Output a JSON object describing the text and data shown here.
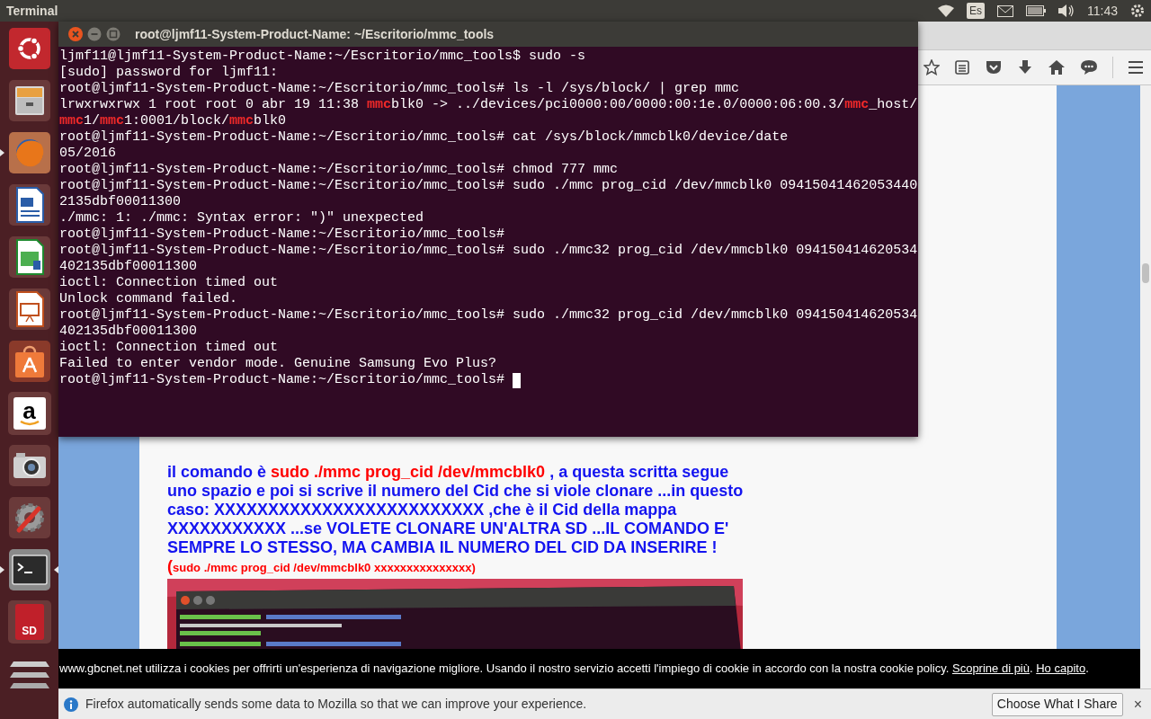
{
  "top_panel": {
    "app_title": "Terminal",
    "keyboard_layout": "Es",
    "time": "11:43"
  },
  "launcher": [
    {
      "kind": "ubuntu",
      "running": false,
      "focused": false
    },
    {
      "kind": "files",
      "running": false,
      "focused": false
    },
    {
      "kind": "firefox",
      "running": true,
      "focused": false
    },
    {
      "kind": "writer",
      "running": false,
      "focused": false
    },
    {
      "kind": "calc",
      "running": false,
      "focused": false
    },
    {
      "kind": "impress",
      "running": false,
      "focused": false
    },
    {
      "kind": "software",
      "running": false,
      "focused": false
    },
    {
      "kind": "amazon",
      "running": false,
      "focused": false,
      "glyph": "a"
    },
    {
      "kind": "camera",
      "running": false,
      "focused": false
    },
    {
      "kind": "settings",
      "running": false,
      "focused": false
    },
    {
      "kind": "terminal",
      "running": true,
      "focused": true
    },
    {
      "kind": "sdcard",
      "running": false,
      "focused": false,
      "glyph": "SD"
    },
    {
      "kind": "drives",
      "running": false,
      "focused": false
    }
  ],
  "terminal": {
    "title": "root@ljmf11-System-Product-Name: ~/Escritorio/mmc_tools",
    "cursor": true,
    "lines": [
      [
        {
          "text": "ljmf11@ljmf11-System-Product-Name:~/Escritorio/mmc_tools$ sudo -s",
          "match": false
        }
      ],
      [
        {
          "text": "[sudo] password for ljmf11:",
          "match": false
        }
      ],
      [
        {
          "text": "root@ljmf11-System-Product-Name:~/Escritorio/mmc_tools# ls -l /sys/block/ | grep mmc",
          "match": false
        }
      ],
      [
        {
          "text": "lrwxrwxrwx 1 root root 0 abr 19 11:38 ",
          "match": false
        },
        {
          "text": "mmc",
          "match": true
        },
        {
          "text": "blk0 -> ../devices/pci0000:00/0000:00:1e.0/0000:06:00.3/",
          "match": false
        },
        {
          "text": "mmc",
          "match": true
        },
        {
          "text": "_host/",
          "match": false
        }
      ],
      [
        {
          "text": "mmc",
          "match": true
        },
        {
          "text": "1/",
          "match": false
        },
        {
          "text": "mmc",
          "match": true
        },
        {
          "text": "1:0001/block/",
          "match": false
        },
        {
          "text": "mmc",
          "match": true
        },
        {
          "text": "blk0",
          "match": false
        }
      ],
      [
        {
          "text": "root@ljmf11-System-Product-Name:~/Escritorio/mmc_tools# cat /sys/block/mmcblk0/device/date",
          "match": false
        }
      ],
      [
        {
          "text": "05/2016",
          "match": false
        }
      ],
      [
        {
          "text": "root@ljmf11-System-Product-Name:~/Escritorio/mmc_tools# chmod 777 mmc",
          "match": false
        }
      ],
      [
        {
          "text": "root@ljmf11-System-Product-Name:~/Escritorio/mmc_tools# sudo ./mmc prog_cid /dev/mmcblk0 09415041462053440",
          "match": false
        }
      ],
      [
        {
          "text": "2135dbf00011300",
          "match": false
        }
      ],
      [
        {
          "text": "./mmc: 1: ./mmc: Syntax error: \")\" unexpected",
          "match": false
        }
      ],
      [
        {
          "text": "root@ljmf11-System-Product-Name:~/Escritorio/mmc_tools#",
          "match": false
        }
      ],
      [
        {
          "text": "root@ljmf11-System-Product-Name:~/Escritorio/mmc_tools# sudo ./mmc32 prog_cid /dev/mmcblk0 094150414620534",
          "match": false
        }
      ],
      [
        {
          "text": "402135dbf00011300",
          "match": false
        }
      ],
      [
        {
          "text": "ioctl: Connection timed out",
          "match": false
        }
      ],
      [
        {
          "text": "Unlock command failed.",
          "match": false
        }
      ],
      [
        {
          "text": "root@ljmf11-System-Product-Name:~/Escritorio/mmc_tools# sudo ./mmc32 prog_cid /dev/mmcblk0 094150414620534",
          "match": false
        }
      ],
      [
        {
          "text": "402135dbf00011300",
          "match": false
        }
      ],
      [
        {
          "text": "ioctl: Connection timed out",
          "match": false
        }
      ],
      [
        {
          "text": "Failed to enter vendor mode. Genuine Samsung Evo Plus?",
          "match": false
        }
      ],
      [
        {
          "text": "root@ljmf11-System-Product-Name:~/Escritorio/mmc_tools# ",
          "match": false
        }
      ]
    ]
  },
  "page": {
    "paragraph": [
      {
        "kind": "text",
        "text": "il comando è "
      },
      {
        "kind": "command",
        "text": "sudo ./mmc prog_cid /dev/mmcblk0"
      },
      {
        "kind": "text",
        "text": " , a questa scritta segue uno spazio e poi si scrive il numero del Cid che si viole clonare ...in questo caso: XXXXXXXXXXXXXXXXXXXXXXXXX ,che è il Cid della mappa XXXXXXXXXXX ...se VOLETE CLONARE UN'ALTRA SD ...IL COMANDO E' SEMPRE LO STESSO, MA CAMBIA IL NUMERO DEL CID DA INSERIRE ! "
      },
      {
        "kind": "command",
        "text": "("
      },
      {
        "kind": "note",
        "text": "sudo ./mmc prog_cid /dev/mmcblk0 xxxxxxxxxxxxxxx)"
      }
    ]
  },
  "cookie_bar": [
    {
      "kind": "text",
      "text": "www.gbcnet.net utilizza i cookies per offrirti un'esperienza di navigazione migliore. Usando il nostro servizio accetti l'impiego di cookie in accordo con la nostra cookie policy. "
    },
    {
      "kind": "link",
      "text": "Scoprine di più"
    },
    {
      "kind": "text",
      "text": ". "
    },
    {
      "kind": "link",
      "text": "Ho capito"
    },
    {
      "kind": "text",
      "text": "."
    }
  ],
  "notification": {
    "message": "Firefox automatically sends some data to Mozilla so that we can improve your experience.",
    "button": "Choose What I Share",
    "close": "×"
  }
}
